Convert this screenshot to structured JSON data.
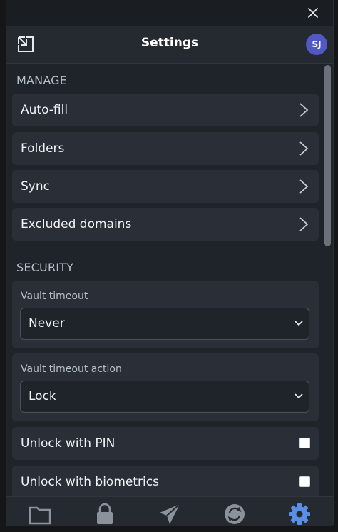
{
  "header": {
    "title": "Settings",
    "avatar_initials": "SJ"
  },
  "sections": {
    "manage": {
      "heading": "MANAGE",
      "items": [
        {
          "label": "Auto-fill"
        },
        {
          "label": "Folders"
        },
        {
          "label": "Sync"
        },
        {
          "label": "Excluded domains"
        }
      ]
    },
    "security": {
      "heading": "SECURITY",
      "vault_timeout": {
        "label": "Vault timeout",
        "value": "Never"
      },
      "vault_timeout_action": {
        "label": "Vault timeout action",
        "value": "Lock"
      },
      "unlock_pin": {
        "label": "Unlock with PIN",
        "checked": false
      },
      "unlock_biometrics": {
        "label": "Unlock with biometrics",
        "checked": false
      }
    }
  },
  "tabs": [
    {
      "icon": "folder-icon"
    },
    {
      "icon": "lock-icon"
    },
    {
      "icon": "send-icon"
    },
    {
      "icon": "sync-icon"
    },
    {
      "icon": "gear-icon",
      "active": true
    }
  ],
  "colors": {
    "accent": "#5a8fe6",
    "icon_inactive": "#8b929c",
    "avatar": "#5058c4"
  }
}
